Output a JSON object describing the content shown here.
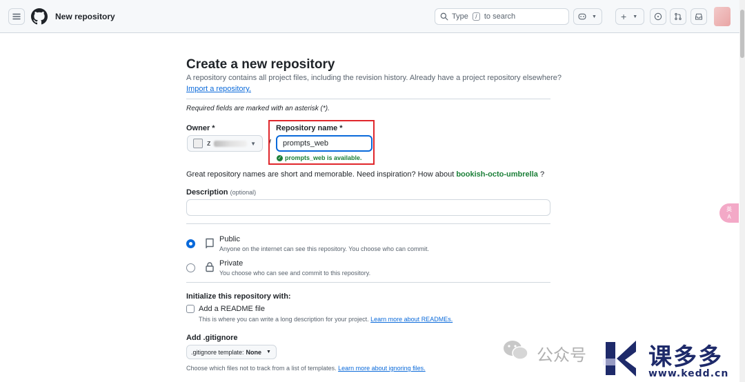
{
  "header": {
    "title": "New repository",
    "search_text_before": "Type",
    "search_key": "/",
    "search_text_after": "to search"
  },
  "page": {
    "heading": "Create a new repository",
    "description": "A repository contains all project files, including the revision history. Already have a project repository elsewhere?",
    "import_link": "Import a repository.",
    "required_note": "Required fields are marked with an asterisk (*)."
  },
  "form": {
    "owner_label": "Owner *",
    "owner_value_visible": "z",
    "separator": "/",
    "repo_name_label": "Repository name *",
    "repo_name_value": "prompts_web",
    "availability": "prompts_web is available.",
    "great_names_text": "Great repository names are short and memorable. Need inspiration? How about",
    "suggestion": "bookish-octo-umbrella",
    "suggestion_suffix": "?",
    "description_label": "Description",
    "description_optional": "(optional)",
    "description_value": ""
  },
  "visibility": {
    "public": {
      "title": "Public",
      "subtitle": "Anyone on the internet can see this repository. You choose who can commit.",
      "selected": true
    },
    "private": {
      "title": "Private",
      "subtitle": "You choose who can see and commit to this repository.",
      "selected": false
    }
  },
  "initialize": {
    "label": "Initialize this repository with:",
    "readme_label": "Add a README file",
    "readme_checked": false,
    "readme_sub": "This is where you can write a long description for your project.",
    "readme_link": "Learn more about READMEs."
  },
  "gitignore": {
    "label": "Add .gitignore",
    "select_prefix": ".gitignore template:",
    "select_value": "None",
    "sub": "Choose which files not to track from a list of templates.",
    "sub_link": "Learn more about ignoring files."
  },
  "overlay": {
    "translate_line1": "英",
    "translate_line2": "A"
  },
  "watermark": {
    "gzh": "公众号",
    "brand": "课多多",
    "url": "www.kedd.cn"
  },
  "colors": {
    "accent": "#0969da",
    "success": "#1a7f37",
    "highlight_box": "#e0262b"
  }
}
